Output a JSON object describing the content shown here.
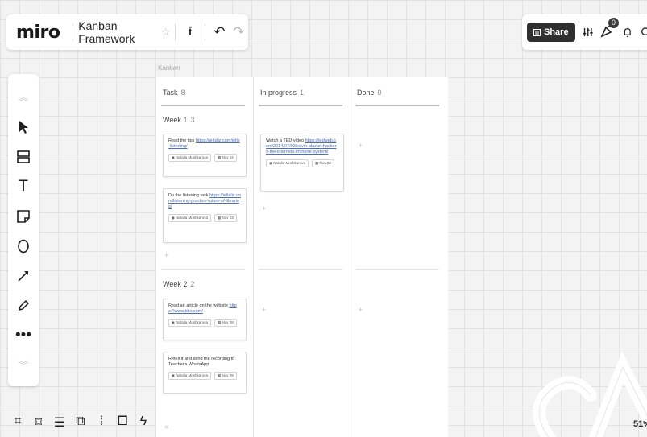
{
  "header": {
    "logo": "miro",
    "board_title": "Kanban Framework",
    "star_icon": "☆",
    "upload_icon": "⭱",
    "undo_icon": "↶",
    "redo_icon": "↷",
    "share_label": "Share",
    "notification_count": "0"
  },
  "toolbar": {
    "tools": [
      "select",
      "templates",
      "text",
      "sticky-note",
      "shapes",
      "pen",
      "highlighter",
      "more"
    ]
  },
  "board": {
    "frame_label": "Kanban",
    "columns": [
      {
        "name": "Task",
        "count": "8"
      },
      {
        "name": "In progress",
        "count": "1"
      },
      {
        "name": "Done",
        "count": "0"
      }
    ],
    "rows": [
      {
        "name": "Week 1",
        "count": "3"
      },
      {
        "name": "Week 2",
        "count": "2"
      }
    ],
    "cards": [
      {
        "text": "Read the tips ",
        "link": "https://ieltsliz.com/ielts-listening/",
        "author": "Natalia Mushkarova",
        "date": "Nov 02"
      },
      {
        "text": "Do the listening task ",
        "link": "https://ieltsliz.com/listening-practice-future-of-libraries/",
        "author": "Natalia Mushkarova",
        "date": "Nov 03"
      },
      {
        "text": "Watch a TED video ",
        "link": "https://tedweb.com/2014/07/03/kevin-alazari-hackers-the-internets-immune-system/",
        "author": "Natalia Mushkarova",
        "date": "Nov 02"
      },
      {
        "text": "Read an article on the website ",
        "link": "https://www.bbc.com/",
        "author": "Natalia Mushkarova",
        "date": "Nov 08"
      },
      {
        "text": "Retell it and send the recording to Teacher's WhatsApp",
        "link": "",
        "author": "Natalia Mushkarova",
        "date": "Nov 09"
      }
    ],
    "add_symbol": "+",
    "collapse_symbol": "«"
  },
  "zoom": "51%"
}
